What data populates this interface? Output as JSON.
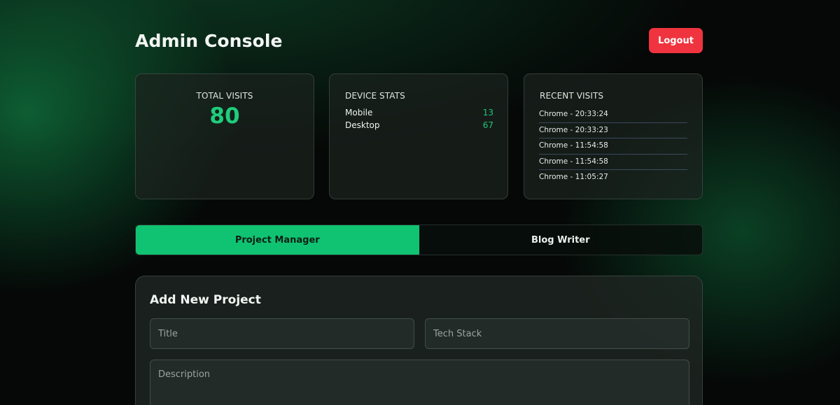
{
  "header": {
    "title": "Admin Console",
    "logout_label": "Logout"
  },
  "stats": {
    "total_visits": {
      "label": "TOTAL VISITS",
      "value": "80"
    },
    "device_stats": {
      "label": "DEVICE STATS",
      "devices": [
        {
          "name": "Mobile",
          "count": "13"
        },
        {
          "name": "Desktop",
          "count": "67"
        }
      ]
    },
    "recent_visits": {
      "label": "RECENT VISITS",
      "items": [
        "Chrome - 20:33:24",
        "Chrome - 20:33:23",
        "Chrome - 11:54:58",
        "Chrome - 11:54:58",
        "Chrome - 11:05:27"
      ]
    }
  },
  "tabs": [
    {
      "label": "Project Manager",
      "active": true
    },
    {
      "label": "Blog Writer",
      "active": false
    }
  ],
  "form": {
    "title": "Add New Project",
    "title_placeholder": "Title",
    "tech_placeholder": "Tech Stack",
    "description_placeholder": "Description"
  },
  "colors": {
    "accent_green": "#10c372",
    "logout_red": "#f0343f",
    "value_green": "#1fcd7c",
    "background": "#050807"
  }
}
